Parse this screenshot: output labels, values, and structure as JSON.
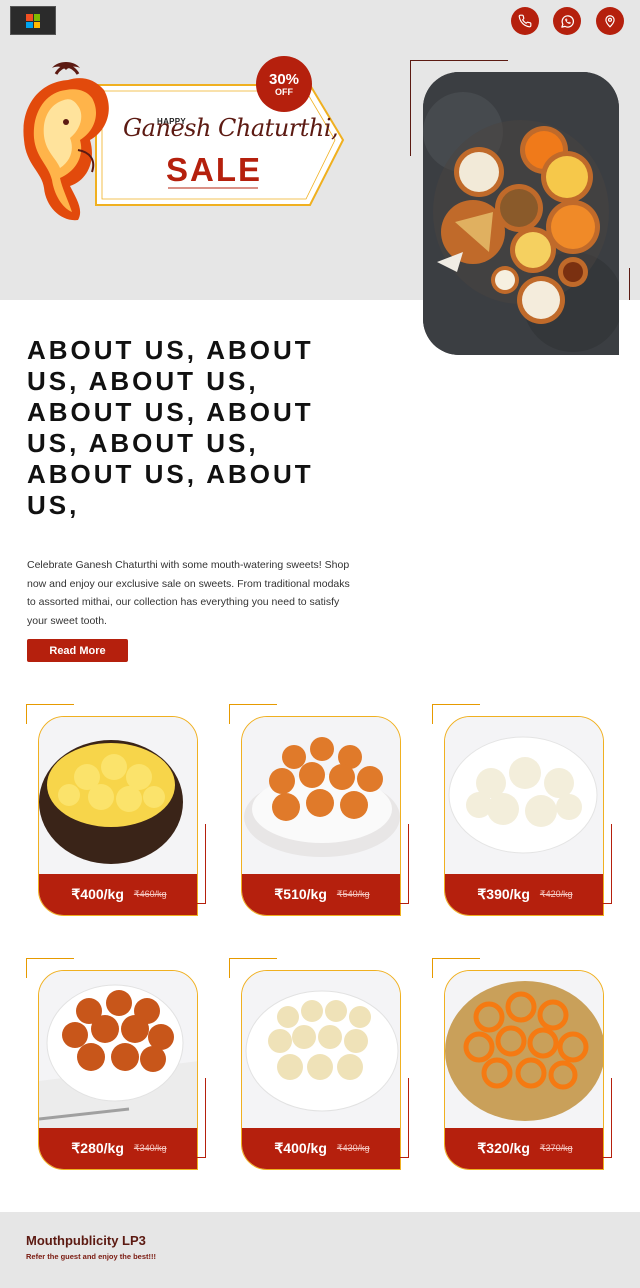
{
  "header": {
    "logo_icon": "windows-logo-icon",
    "contact_icons": [
      "phone-icon",
      "whatsapp-icon",
      "location-pin-icon"
    ]
  },
  "hero": {
    "badge_percent": "30%",
    "badge_off": "OFF",
    "happy": "HAPPY",
    "title_script": "Ganesh Chaturthi,",
    "sale": "SALE"
  },
  "about": {
    "title": "ABOUT US, ABOUT US, ABOUT US, ABOUT US, ABOUT US, ABOUT US, ABOUT US, ABOUT US,",
    "text": "Celebrate Ganesh Chaturthi with some mouth-watering sweets! Shop now and enjoy our exclusive sale on sweets. From traditional modaks to assorted mithai, our collection has everything you need to satisfy your sweet tooth.",
    "button": "Read More"
  },
  "products": [
    {
      "price": "₹400/kg",
      "old_price": "₹460/kg",
      "sweet": "rasmalai"
    },
    {
      "price": "₹510/kg",
      "old_price": "₹540/kg",
      "sweet": "motichoor-laddu"
    },
    {
      "price": "₹390/kg",
      "old_price": "₹420/kg",
      "sweet": "rasgulla"
    },
    {
      "price": "₹280/kg",
      "old_price": "₹340/kg",
      "sweet": "gulab-jamun"
    },
    {
      "price": "₹400/kg",
      "old_price": "₹430/kg",
      "sweet": "besan-laddu"
    },
    {
      "price": "₹320/kg",
      "old_price": "₹370/kg",
      "sweet": "jalebi"
    }
  ],
  "footer": {
    "title": "Mouthpublicity LP3",
    "subtitle": "Refer the guest and enjoy the best!!!"
  },
  "colors": {
    "brand_red": "#b5200d",
    "accent_gold": "#f0b020",
    "page_bg": "#e6e6e6",
    "dark_brown": "#5c1a12"
  }
}
